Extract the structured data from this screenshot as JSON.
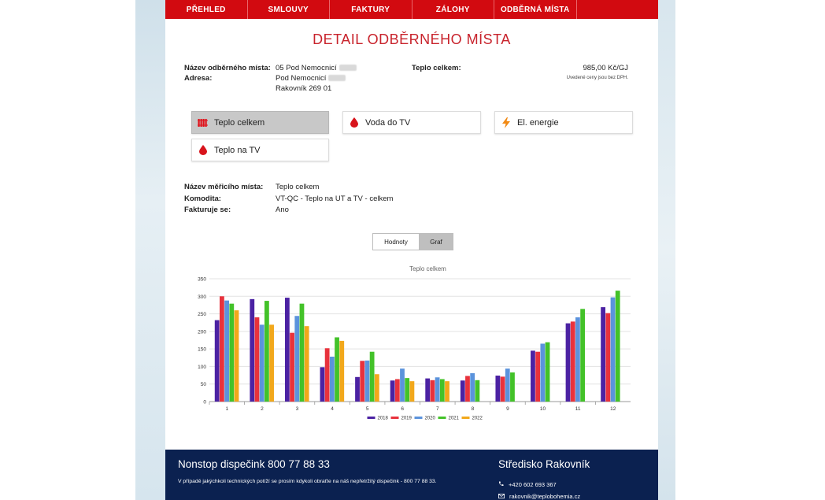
{
  "nav": [
    "PŘEHLED",
    "SMLOUVY",
    "FAKTURY",
    "ZÁLOHY",
    "ODBĚRNÁ MÍSTA"
  ],
  "page_title": "DETAIL ODBĚRNÉHO MÍSTA",
  "place": {
    "name_label": "Název odběrného místa:",
    "name_value": "05 Pod Nemocnicí",
    "address_label": "Adresa:",
    "address_line1": "Pod Nemocnicí",
    "address_line2": "Rakovník 269 01",
    "heat_label": "Teplo celkem:",
    "heat_price": "985,00 Kč/GJ",
    "price_note": "Uvedené ceny jsou bez DPH."
  },
  "tiles": [
    {
      "label": "Teplo celkem",
      "icon": "radiator-icon",
      "active": true
    },
    {
      "label": "Voda do TV",
      "icon": "water-drop-icon",
      "active": false
    },
    {
      "label": "El. energie",
      "icon": "lightning-icon",
      "active": false
    },
    {
      "label": "Teplo na TV",
      "icon": "water-drop-icon",
      "active": false
    }
  ],
  "meter": {
    "name_label": "Název měřicího místa:",
    "name_value": "Teplo celkem",
    "commodity_label": "Komodita:",
    "commodity_value": "VT-QC - Teplo na UT a TV - celkem",
    "invoiced_label": "Fakturuje se:",
    "invoiced_value": "Ano"
  },
  "view_toggle": {
    "values_label": "Hodnoty",
    "graph_label": "Graf",
    "selected": "Graf"
  },
  "chart_data": {
    "type": "bar",
    "title": "Teplo celkem",
    "categories": [
      "1",
      "2",
      "3",
      "4",
      "5",
      "6",
      "7",
      "8",
      "9",
      "10",
      "11",
      "12"
    ],
    "ylim": [
      0,
      350
    ],
    "yticks": [
      0,
      50,
      100,
      150,
      200,
      250,
      300,
      350
    ],
    "grid": true,
    "legend_position": "bottom",
    "series": [
      {
        "name": "2018",
        "color": "#4b22a3",
        "values": [
          232,
          292,
          296,
          98,
          70,
          60,
          66,
          60,
          74,
          145,
          223,
          269
        ]
      },
      {
        "name": "2019",
        "color": "#e8323c",
        "values": [
          300,
          240,
          196,
          152,
          116,
          64,
          61,
          73,
          71,
          142,
          228,
          252
        ]
      },
      {
        "name": "2020",
        "color": "#5b93dc",
        "values": [
          288,
          219,
          244,
          128,
          117,
          94,
          69,
          81,
          94,
          165,
          240,
          297
        ]
      },
      {
        "name": "2021",
        "color": "#43c229",
        "values": [
          279,
          287,
          279,
          183,
          142,
          67,
          64,
          61,
          83,
          169,
          264,
          316
        ]
      },
      {
        "name": "2022",
        "color": "#f2a81b",
        "values": [
          260,
          219,
          215,
          173,
          78,
          58,
          58,
          null,
          null,
          null,
          null,
          null
        ]
      }
    ]
  },
  "footer": {
    "dispatch_title": "Nonstop dispečink 800 77 88 33",
    "dispatch_text": "V případě jakýchkoli technických potíží se prosím kdykoli obraťte na náš nepřetržitý dispečink - 800 77 88 33.",
    "center_title": "Středisko Rakovník",
    "phone": "+420 602 693 367",
    "email": "rakovnik@teplobohemia.cz"
  }
}
